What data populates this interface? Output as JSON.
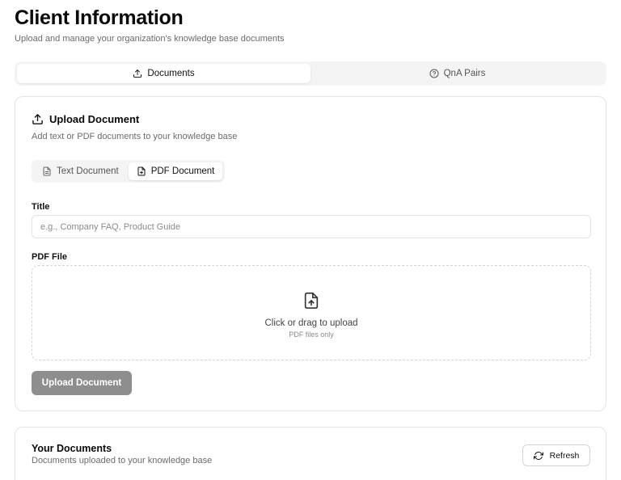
{
  "header": {
    "title": "Client Information",
    "subtitle": "Upload and manage your organization's knowledge base documents"
  },
  "tabs": [
    {
      "label": "Documents",
      "icon": "upload-icon",
      "active": true
    },
    {
      "label": "QnA Pairs",
      "icon": "help-circle-icon",
      "active": false
    }
  ],
  "upload_card": {
    "title": "Upload Document",
    "description": "Add text or PDF documents to your knowledge base",
    "doc_types": [
      {
        "label": "Text Document",
        "icon": "file-text-icon",
        "active": false
      },
      {
        "label": "PDF Document",
        "icon": "file-plus-icon",
        "active": true
      }
    ],
    "title_field": {
      "label": "Title",
      "value": "",
      "placeholder": "e.g., Company FAQ, Product Guide"
    },
    "file_field": {
      "label": "PDF File"
    },
    "dropzone": {
      "main": "Click or drag to upload",
      "sub": "PDF files only",
      "icon": "file-upload-icon"
    },
    "upload_button": "Upload Document"
  },
  "docs_card": {
    "title": "Your Documents",
    "description": "Documents uploaded to your knowledge base",
    "refresh_button": "Refresh"
  },
  "colors": {
    "disabled_button": "#8e8e8e",
    "border": "#e4e4e7",
    "muted_text": "#6b6b6b",
    "tab_background": "#f4f4f5"
  }
}
